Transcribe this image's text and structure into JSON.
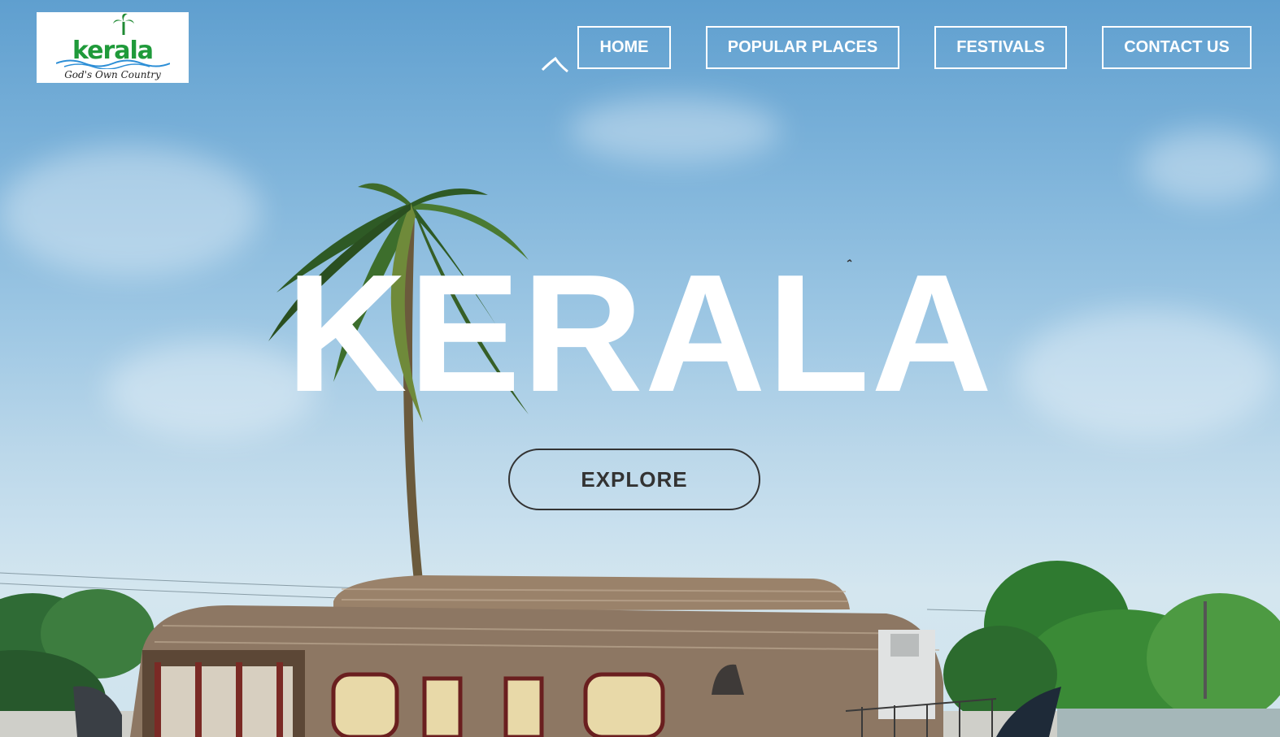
{
  "logo": {
    "wordmark": "kerala",
    "tagline": "God's Own Country"
  },
  "nav": {
    "items": [
      {
        "label": "HOME"
      },
      {
        "label": "POPULAR PLACES"
      },
      {
        "label": "FESTIVALS"
      },
      {
        "label": "CONTACT US"
      }
    ]
  },
  "hero": {
    "title": "KERALA",
    "cta_label": "EXPLORE"
  },
  "colors": {
    "sky": "#7db3da",
    "nav_text": "#ffffff",
    "title": "#ffffff",
    "cta": "#333333",
    "logo_green": "#1f9a3a"
  },
  "icons": {
    "logo_palm": "palm-tree-icon",
    "logo_wave": "wave-icon"
  }
}
